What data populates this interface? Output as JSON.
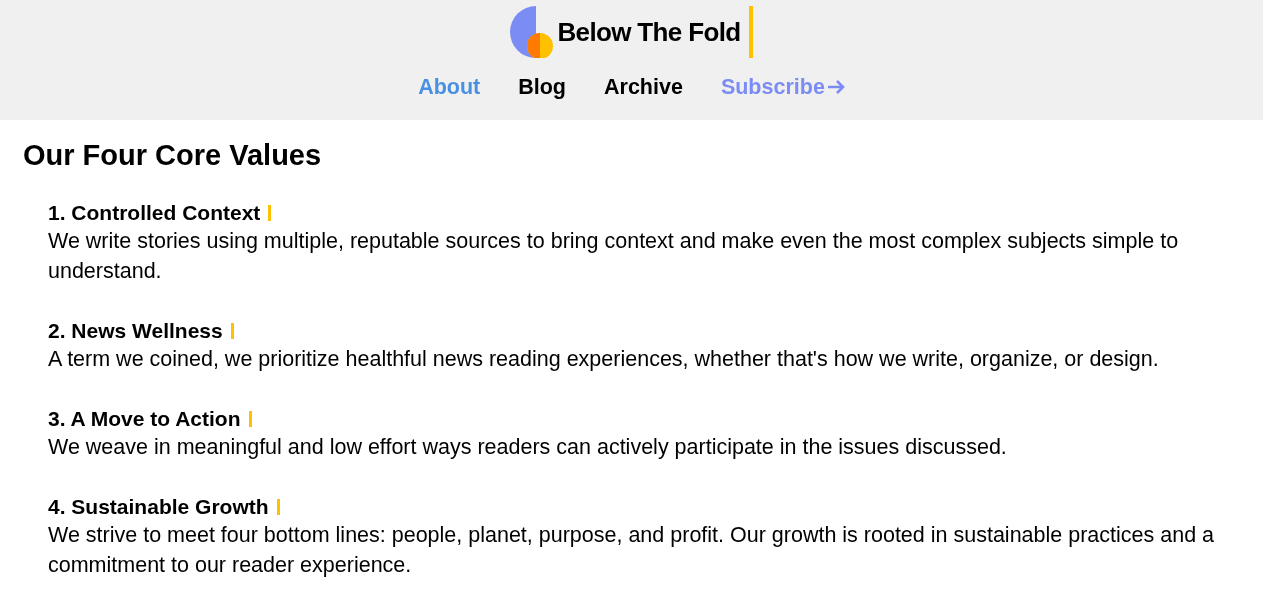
{
  "brand": {
    "name": "Below The Fold"
  },
  "nav": [
    {
      "label": "About",
      "color": "#4a90e2",
      "arrow": false
    },
    {
      "label": "Blog",
      "color": "#000000",
      "arrow": false
    },
    {
      "label": "Archive",
      "color": "#000000",
      "arrow": false
    },
    {
      "label": "Subscribe",
      "color": "#7b8cf5",
      "arrow": true
    }
  ],
  "heading": "Our Four Core Values",
  "values": [
    {
      "title": "1. Controlled Context",
      "text": "We write stories using multiple, reputable sources to bring context and make even the most complex subjects simple to understand."
    },
    {
      "title": "2. News Wellness",
      "text": "A term we coined, we prioritize healthful news reading experiences, whether that's how we write, organize, or design."
    },
    {
      "title": "3. A Move to Action",
      "text": "We weave in meaningful and low effort ways readers can actively participate in the issues discussed."
    },
    {
      "title": "4. Sustainable Growth",
      "text": "We strive to meet four bottom lines: people, planet, purpose, and profit. Our growth is rooted in sustainable practices and a commitment to our reader experience."
    }
  ]
}
